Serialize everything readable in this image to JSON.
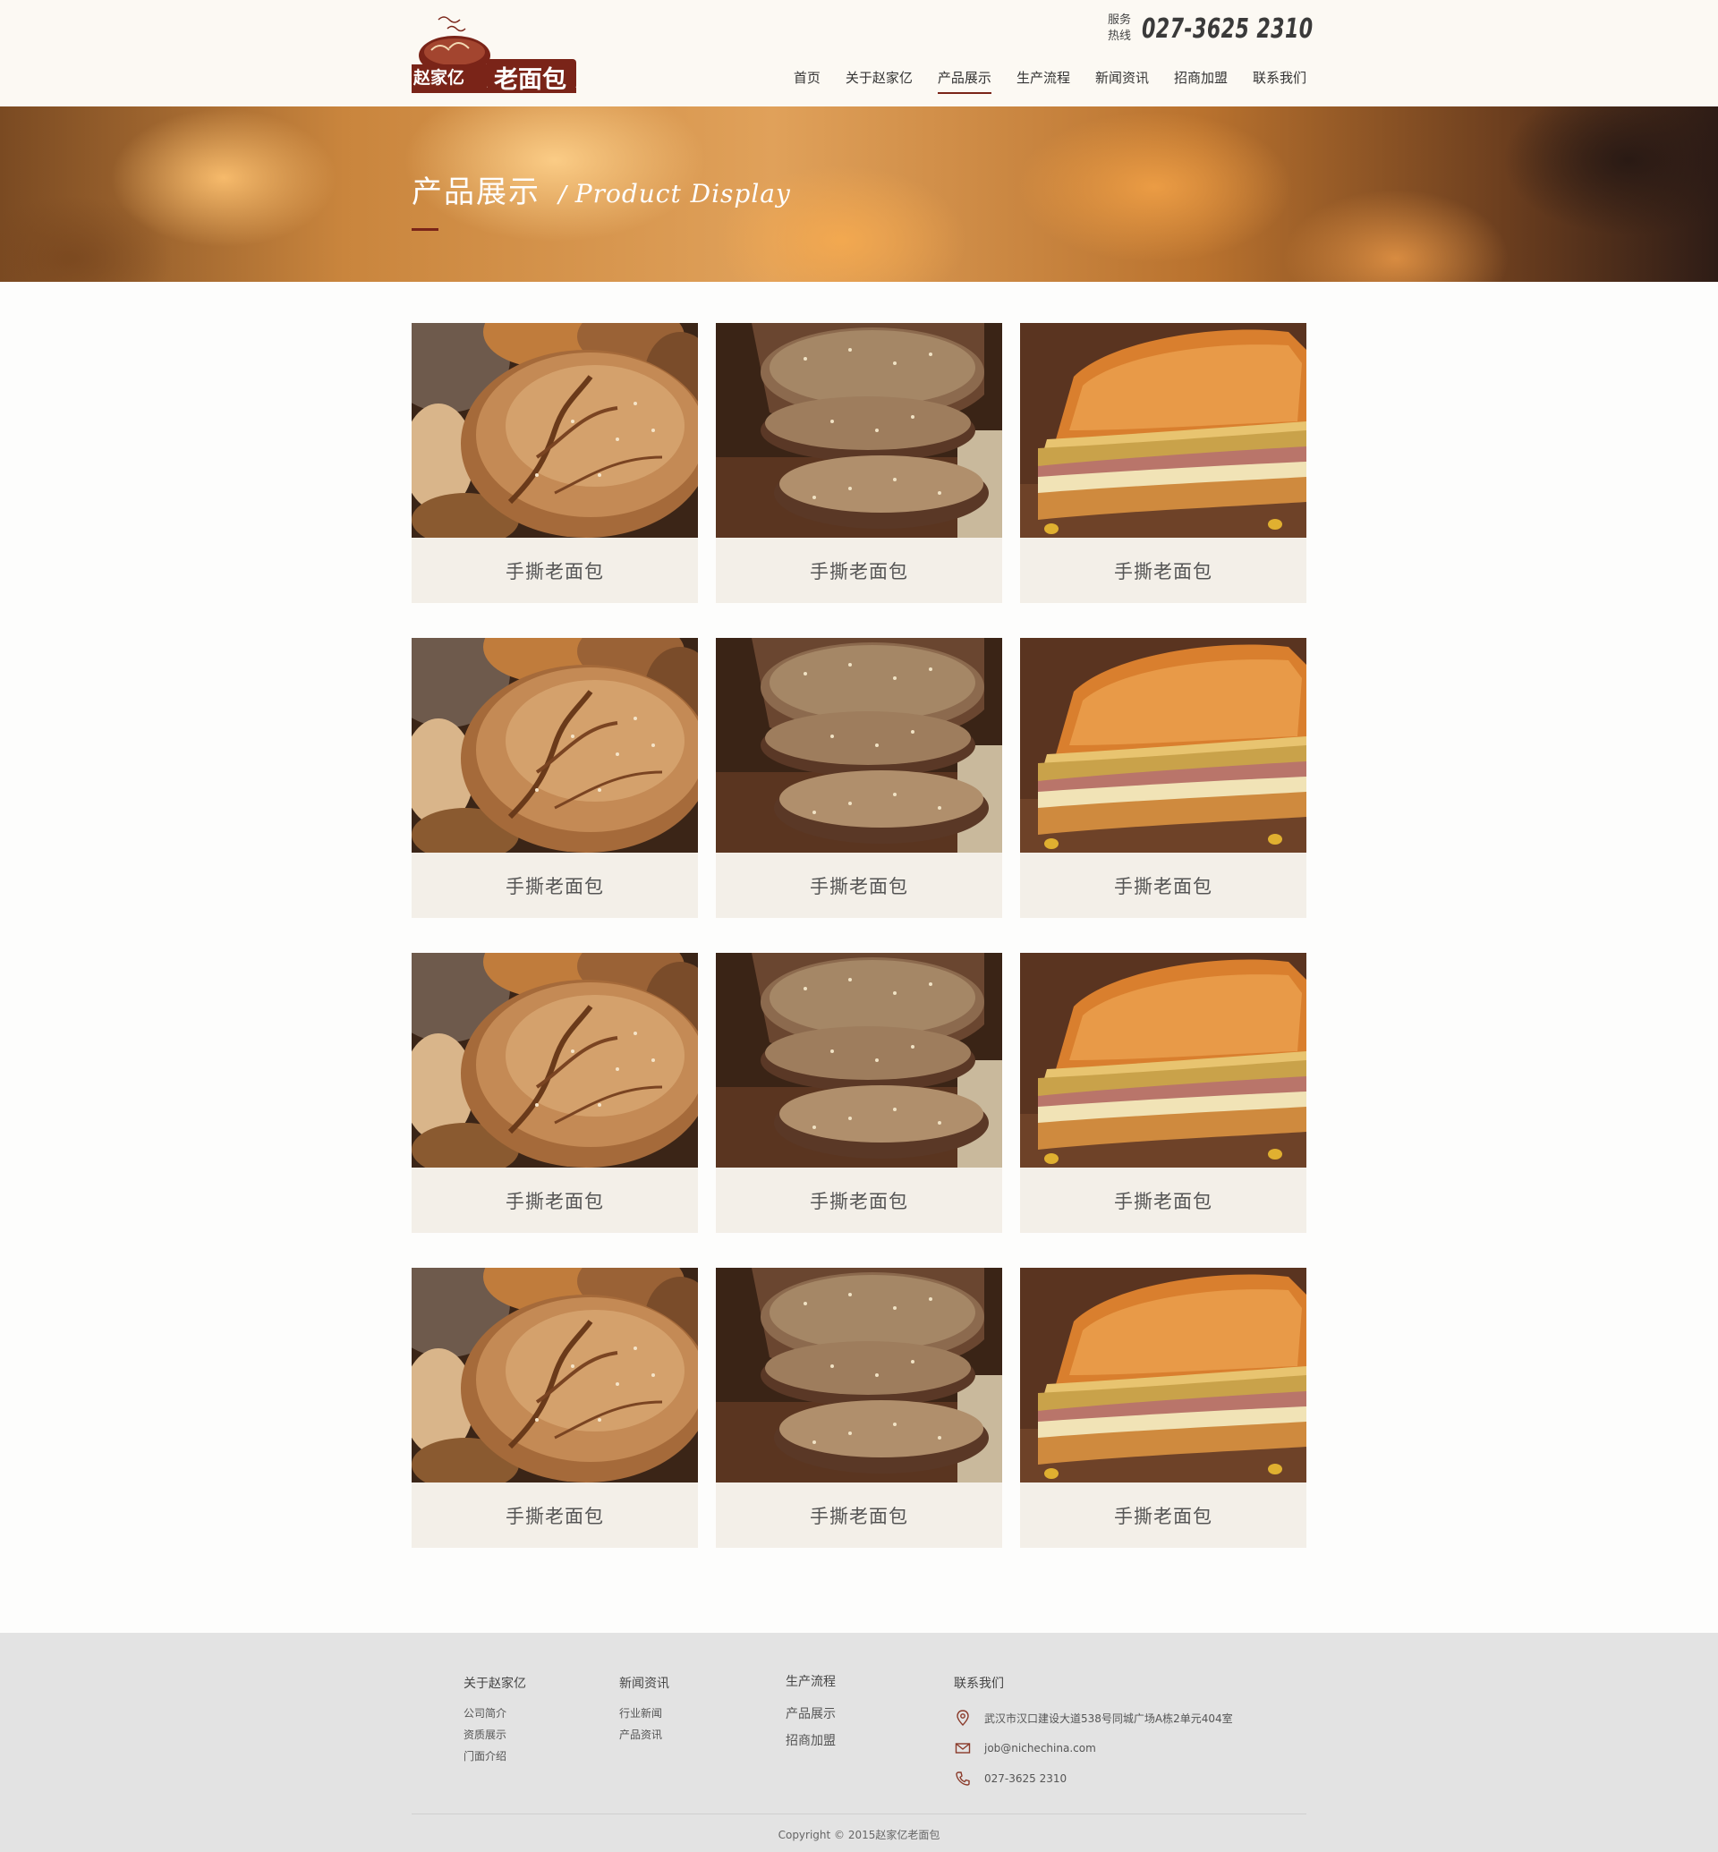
{
  "brand": {
    "name": "赵家亿老面包",
    "name_prefix": "赵家亿",
    "name_suffix": "老面包",
    "accent_color": "#7a2418"
  },
  "header": {
    "hotline_label": "服务热线",
    "hotline_number": "027-3625 2310"
  },
  "nav": {
    "items": [
      {
        "label": "首页",
        "active": false
      },
      {
        "label": "关于赵家亿",
        "active": false
      },
      {
        "label": "产品展示",
        "active": true
      },
      {
        "label": "生产流程",
        "active": false
      },
      {
        "label": "新闻资讯",
        "active": false
      },
      {
        "label": "招商加盟",
        "active": false
      },
      {
        "label": "联系我们",
        "active": false
      }
    ]
  },
  "banner": {
    "title_cn": "产品展示",
    "separator": "/",
    "title_en": "Product Display"
  },
  "products": [
    {
      "title": "手撕老面包",
      "image": "round-loaf"
    },
    {
      "title": "手撕老面包",
      "image": "sliced-rye"
    },
    {
      "title": "手撕老面包",
      "image": "sandwich"
    },
    {
      "title": "手撕老面包",
      "image": "round-loaf"
    },
    {
      "title": "手撕老面包",
      "image": "sliced-rye"
    },
    {
      "title": "手撕老面包",
      "image": "sandwich"
    },
    {
      "title": "手撕老面包",
      "image": "round-loaf"
    },
    {
      "title": "手撕老面包",
      "image": "sliced-rye"
    },
    {
      "title": "手撕老面包",
      "image": "sandwich"
    },
    {
      "title": "手撕老面包",
      "image": "round-loaf"
    },
    {
      "title": "手撕老面包",
      "image": "sliced-rye"
    },
    {
      "title": "手撕老面包",
      "image": "sandwich"
    }
  ],
  "footer": {
    "col_about": {
      "title": "关于赵家亿",
      "links": [
        "公司简介",
        "资质展示",
        "门面介绍"
      ]
    },
    "col_news": {
      "title": "新闻资讯",
      "links": [
        "行业新闻",
        "产品资讯"
      ]
    },
    "col_misc": {
      "links": [
        "生产流程",
        "产品展示",
        "招商加盟"
      ]
    },
    "col_contact": {
      "title": "联系我们",
      "address": "武汉市汉口建设大道538号同城广场A栋2单元404室",
      "email": "job@nichechina.com",
      "phone": "027-3625 2310"
    },
    "copyright": "Copyright © 2015赵家亿老面包"
  }
}
